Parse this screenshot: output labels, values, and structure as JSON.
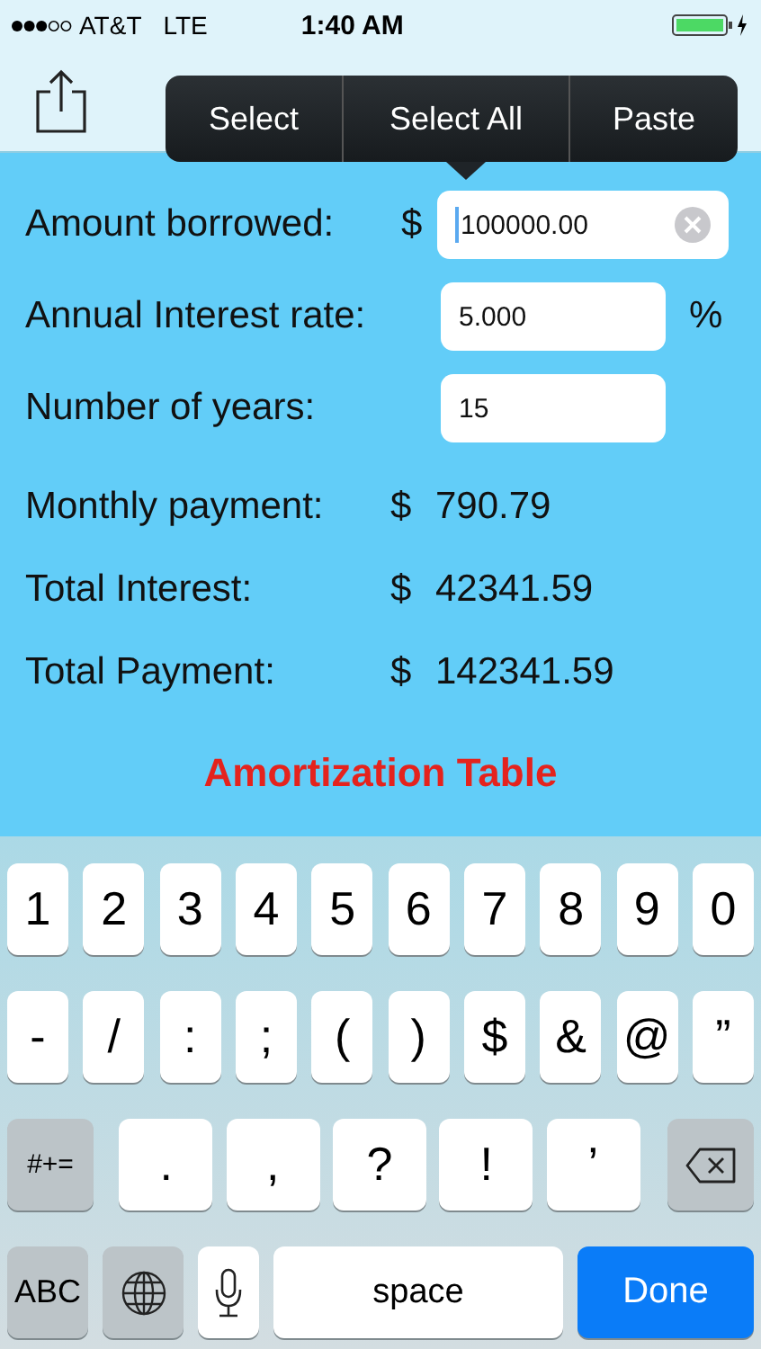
{
  "status_bar": {
    "carrier": "AT&T",
    "network": "LTE",
    "time": "1:40 AM"
  },
  "edit_menu": {
    "items": [
      "Select",
      "Select All",
      "Paste"
    ]
  },
  "inputs": [
    {
      "label": "Amount borrowed:",
      "prefix": "$",
      "value": "100000.00",
      "focused": true
    },
    {
      "label": "Annual Interest rate:",
      "value": "5.000",
      "suffix": "%",
      "focused": false
    },
    {
      "label": "Number of years:",
      "value": "15",
      "focused": false
    }
  ],
  "results": [
    {
      "label": "Monthly payment:",
      "currency": "$",
      "value": "790.79"
    },
    {
      "label": "Total Interest:",
      "currency": "$",
      "value": "42341.59"
    },
    {
      "label": "Total Payment:",
      "currency": "$",
      "value": "142341.59"
    }
  ],
  "amortization_link": "Amortization Table",
  "keyboard": {
    "number_row": [
      {
        "kind": "char",
        "label": "1"
      },
      {
        "kind": "char",
        "label": "2"
      },
      {
        "kind": "char",
        "label": "3"
      },
      {
        "kind": "char",
        "label": "4"
      },
      {
        "kind": "char",
        "label": "5"
      },
      {
        "kind": "char",
        "label": "6"
      },
      {
        "kind": "char",
        "label": "7"
      },
      {
        "kind": "char",
        "label": "8"
      },
      {
        "kind": "char",
        "label": "9"
      },
      {
        "kind": "char",
        "label": "0"
      }
    ],
    "symbol_row": [
      {
        "kind": "char",
        "label": "-"
      },
      {
        "kind": "char",
        "label": "/"
      },
      {
        "kind": "char",
        "label": ":"
      },
      {
        "kind": "char",
        "label": ";"
      },
      {
        "kind": "char",
        "label": "("
      },
      {
        "kind": "char",
        "label": ")"
      },
      {
        "kind": "char",
        "label": "$"
      },
      {
        "kind": "char",
        "label": "&"
      },
      {
        "kind": "char",
        "label": "@"
      },
      {
        "kind": "char",
        "label": "”"
      }
    ],
    "punctuation_row": [
      {
        "kind": "mod",
        "label": "#+="
      },
      {
        "kind": "wide",
        "label": "."
      },
      {
        "kind": "wide",
        "label": ","
      },
      {
        "kind": "wide",
        "label": "?"
      },
      {
        "kind": "wide",
        "label": "!"
      },
      {
        "kind": "wide",
        "label": "’"
      },
      {
        "kind": "delete"
      }
    ],
    "bottom_row": [
      {
        "kind": "abc",
        "label": "ABC"
      },
      {
        "kind": "globe"
      },
      {
        "kind": "mic"
      },
      {
        "kind": "space",
        "label": "space"
      },
      {
        "kind": "done",
        "label": "Done"
      }
    ]
  }
}
